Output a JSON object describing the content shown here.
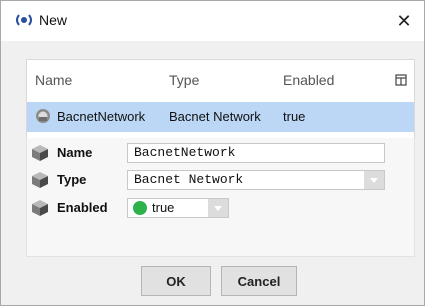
{
  "window": {
    "title": "New",
    "icons": {
      "app": "network-broadcast-icon",
      "close": "close-icon"
    }
  },
  "table": {
    "columns": [
      "Name",
      "Type",
      "Enabled"
    ],
    "rows": [
      {
        "name": "BacnetNetwork",
        "type": "Bacnet Network",
        "enabled": "true",
        "icon": "network-globe-icon"
      }
    ],
    "column_menu_icon": "column-chooser-icon",
    "selected_row_color": "#bcd7f5"
  },
  "properties": {
    "name": {
      "label": "Name",
      "value": "BacnetNetwork",
      "icon": "cube-icon"
    },
    "type": {
      "label": "Type",
      "value": "Bacnet Network",
      "icon": "cube-icon"
    },
    "enabled": {
      "label": "Enabled",
      "value": "true",
      "icon": "cube-icon",
      "status_color": "#2fb14c"
    }
  },
  "buttons": {
    "ok": "OK",
    "cancel": "Cancel"
  }
}
